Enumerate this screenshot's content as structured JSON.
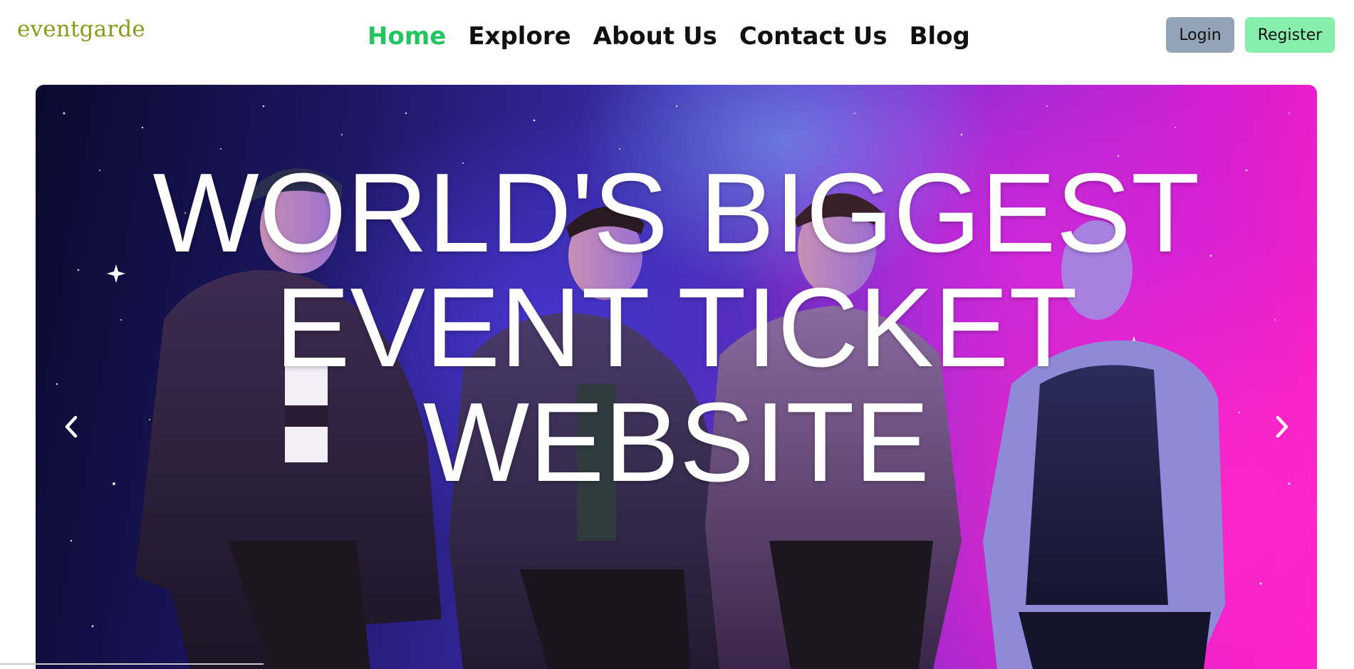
{
  "brand": {
    "name": "eventgarde",
    "color": "#8a9a1a"
  },
  "nav": {
    "items": [
      {
        "label": "Home",
        "active": true
      },
      {
        "label": "Explore",
        "active": false
      },
      {
        "label": "About Us",
        "active": false
      },
      {
        "label": "Contact Us",
        "active": false
      },
      {
        "label": "Blog",
        "active": false
      }
    ],
    "active_color": "#22c55e"
  },
  "auth": {
    "login_label": "Login",
    "register_label": "Register",
    "login_color": "#94a3b8",
    "register_color": "#86efac"
  },
  "hero": {
    "title_lines": [
      "WORLD'S BIGGEST",
      "EVENT TICKET",
      "WEBSITE"
    ],
    "prev_icon": "chevron-left-icon",
    "next_icon": "chevron-right-icon"
  }
}
